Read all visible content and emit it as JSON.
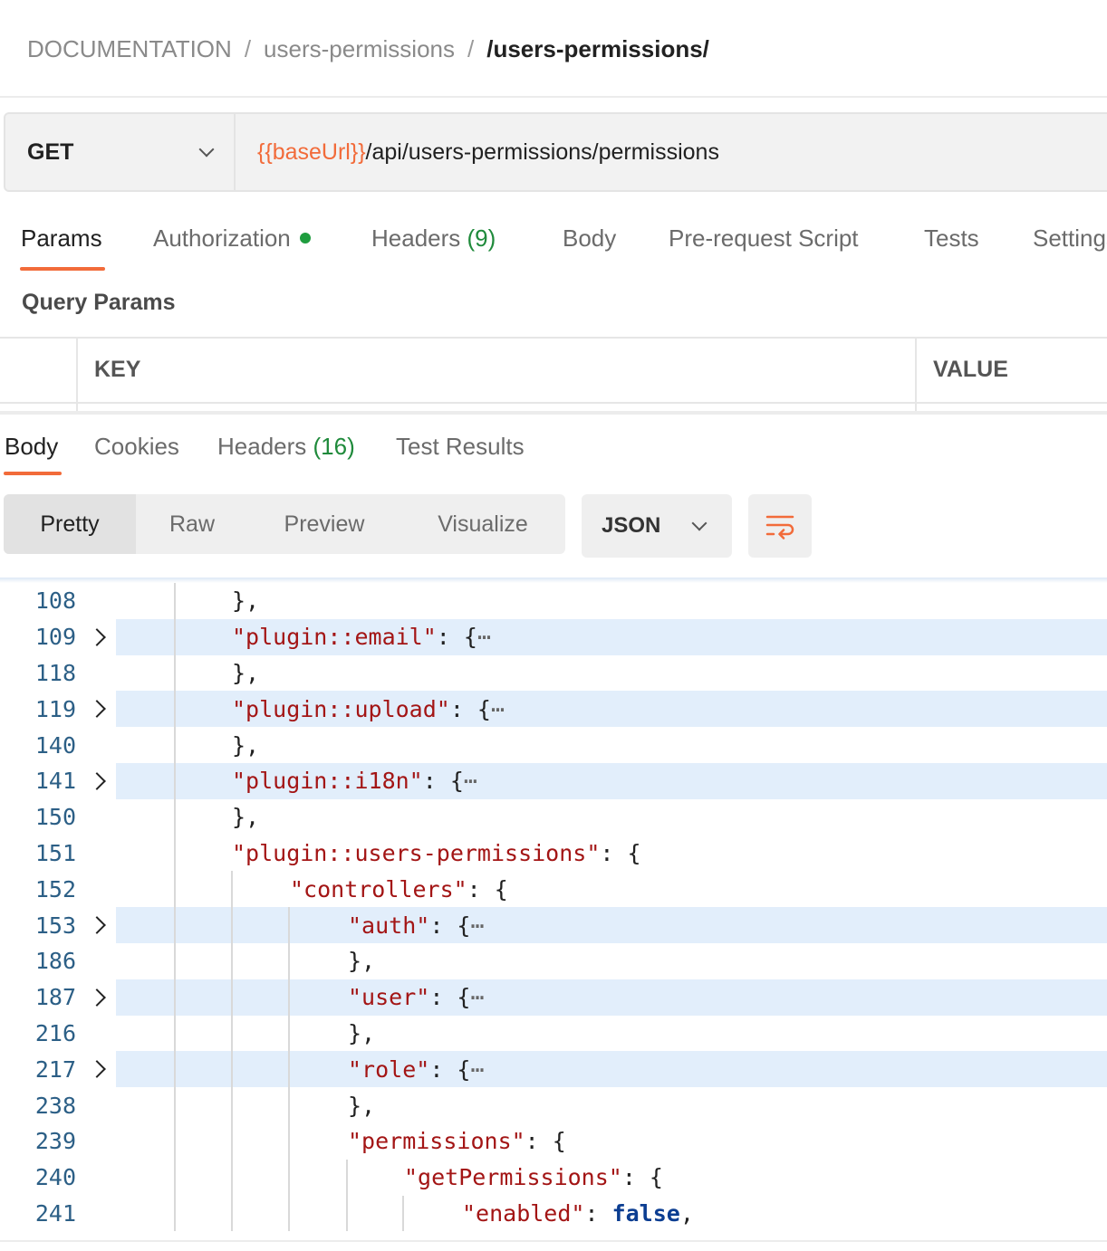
{
  "breadcrumb": {
    "root": "DOCUMENTATION",
    "folder": "users-permissions",
    "current": "/users-permissions/"
  },
  "request": {
    "method": "GET",
    "url_variable": "{{baseUrl}}",
    "url_path": "/api/users-permissions/permissions"
  },
  "request_tabs": {
    "params": "Params",
    "authorization": "Authorization",
    "headers": "Headers",
    "headers_count": "(9)",
    "body": "Body",
    "prerequest": "Pre-request Script",
    "tests": "Tests",
    "settings": "Settings"
  },
  "query_params": {
    "title": "Query Params",
    "key_header": "KEY",
    "value_header": "VALUE"
  },
  "response_tabs": {
    "body": "Body",
    "cookies": "Cookies",
    "headers": "Headers",
    "headers_count": "(16)",
    "test_results": "Test Results"
  },
  "view_modes": {
    "pretty": "Pretty",
    "raw": "Raw",
    "preview": "Preview",
    "visualize": "Visualize"
  },
  "format": {
    "selected": "JSON"
  },
  "code_lines": [
    {
      "n": "108",
      "text": "},"
    },
    {
      "n": "109",
      "key": "\"plugin::email\"",
      "rest": ": {"
    },
    {
      "n": "118",
      "text": "},"
    },
    {
      "n": "119",
      "key": "\"plugin::upload\"",
      "rest": ": {"
    },
    {
      "n": "140",
      "text": "},"
    },
    {
      "n": "141",
      "key": "\"plugin::i18n\"",
      "rest": ": {"
    },
    {
      "n": "150",
      "text": "},"
    },
    {
      "n": "151",
      "key": "\"plugin::users-permissions\"",
      "rest": ": {"
    },
    {
      "n": "152",
      "key": "\"controllers\"",
      "rest": ": {"
    },
    {
      "n": "153",
      "key": "\"auth\"",
      "rest": ": {"
    },
    {
      "n": "186",
      "text": "},"
    },
    {
      "n": "187",
      "key": "\"user\"",
      "rest": ": {"
    },
    {
      "n": "216",
      "text": "},"
    },
    {
      "n": "217",
      "key": "\"role\"",
      "rest": ": {"
    },
    {
      "n": "238",
      "text": "},"
    },
    {
      "n": "239",
      "key": "\"permissions\"",
      "rest": ": {"
    },
    {
      "n": "240",
      "key": "\"getPermissions\"",
      "rest": ": {"
    },
    {
      "n": "241",
      "key": "\"enabled\"",
      "rest": ": ",
      "bool": "false",
      "tail": ","
    }
  ],
  "colors": {
    "accent": "#f26b3a",
    "count_green": "#1f8a3b",
    "auth_dot": "#1f9d3f",
    "json_key": "#a31515",
    "json_bool": "#0b3d91",
    "line_number": "#2c5f86",
    "fold_highlight": "#e2eefb"
  },
  "icons": {
    "method_dropdown": "chevron-down-icon",
    "format_dropdown": "chevron-down-icon",
    "wrap": "wrap-lines-icon",
    "fold": "chevron-right-icon"
  }
}
